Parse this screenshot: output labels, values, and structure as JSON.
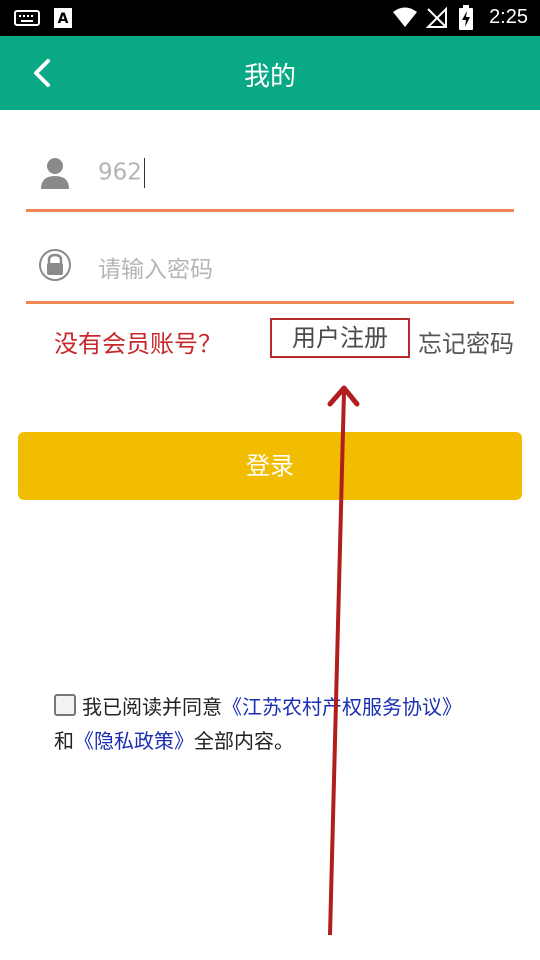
{
  "status_bar": {
    "time": "2:25"
  },
  "app_bar": {
    "title": "我的"
  },
  "form": {
    "username_value": "962",
    "password_placeholder": "请输入密码"
  },
  "links": {
    "no_account": "没有会员账号？",
    "register": "用户注册",
    "forgot": "忘记密码"
  },
  "login_button": "登录",
  "agreement": {
    "prefix": "我已阅读并同意",
    "service_link": "《江苏农村产权服务协议》",
    "and": "和",
    "privacy_link": "《隐私政策》",
    "suffix": "全部内容。"
  },
  "colors": {
    "app_bar": "#0aa985",
    "underline": "#ef8752",
    "login_button": "#f2bd00",
    "question_text": "#c8282c",
    "link_blue": "#1a2fb3",
    "annotation_arrow": "#b01e1e"
  }
}
